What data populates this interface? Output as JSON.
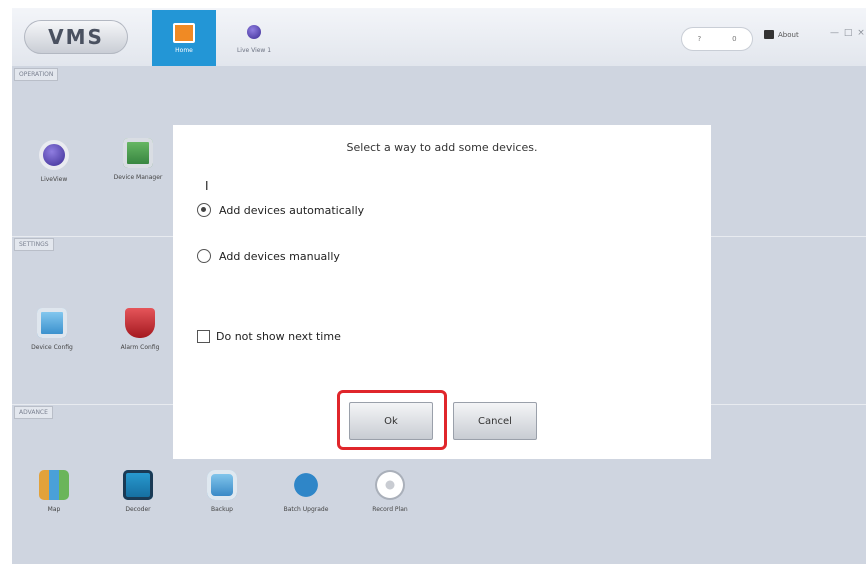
{
  "app": {
    "logo": "VMS"
  },
  "tabs": [
    {
      "label": "Home"
    },
    {
      "label": "Live View 1"
    }
  ],
  "header": {
    "pill_left": "?",
    "pill_right": "0",
    "about_label": "About",
    "window_controls": "— □ ×"
  },
  "sections": [
    {
      "label": "OPERATION",
      "apps": [
        {
          "label": "LiveView",
          "icon": "live-view-icon"
        },
        {
          "label": "Device Manager",
          "icon": "device-manager-icon"
        }
      ]
    },
    {
      "label": "SETTINGS",
      "apps": [
        {
          "label": "Device Config",
          "icon": "device-config-icon"
        },
        {
          "label": "Alarm Config",
          "icon": "alarm-config-icon"
        }
      ]
    },
    {
      "label": "ADVANCE",
      "apps": [
        {
          "label": "Map",
          "icon": "map-icon"
        },
        {
          "label": "Decoder",
          "icon": "decoder-icon"
        },
        {
          "label": "Backup",
          "icon": "backup-icon"
        },
        {
          "label": "Batch Upgrade",
          "icon": "batch-upgrade-icon"
        },
        {
          "label": "Record Plan",
          "icon": "record-plan-icon"
        }
      ]
    }
  ],
  "dialog": {
    "title": "Select a way to add some devices.",
    "options": [
      {
        "label": "Add devices automatically",
        "selected": true
      },
      {
        "label": "Add devices manually",
        "selected": false
      }
    ],
    "checkbox_label": "Do not show next time",
    "ok_label": "Ok",
    "cancel_label": "Cancel"
  },
  "colors": {
    "accent": "#2396d6",
    "highlight": "#e0262b",
    "home_icon": "#f08a24"
  }
}
